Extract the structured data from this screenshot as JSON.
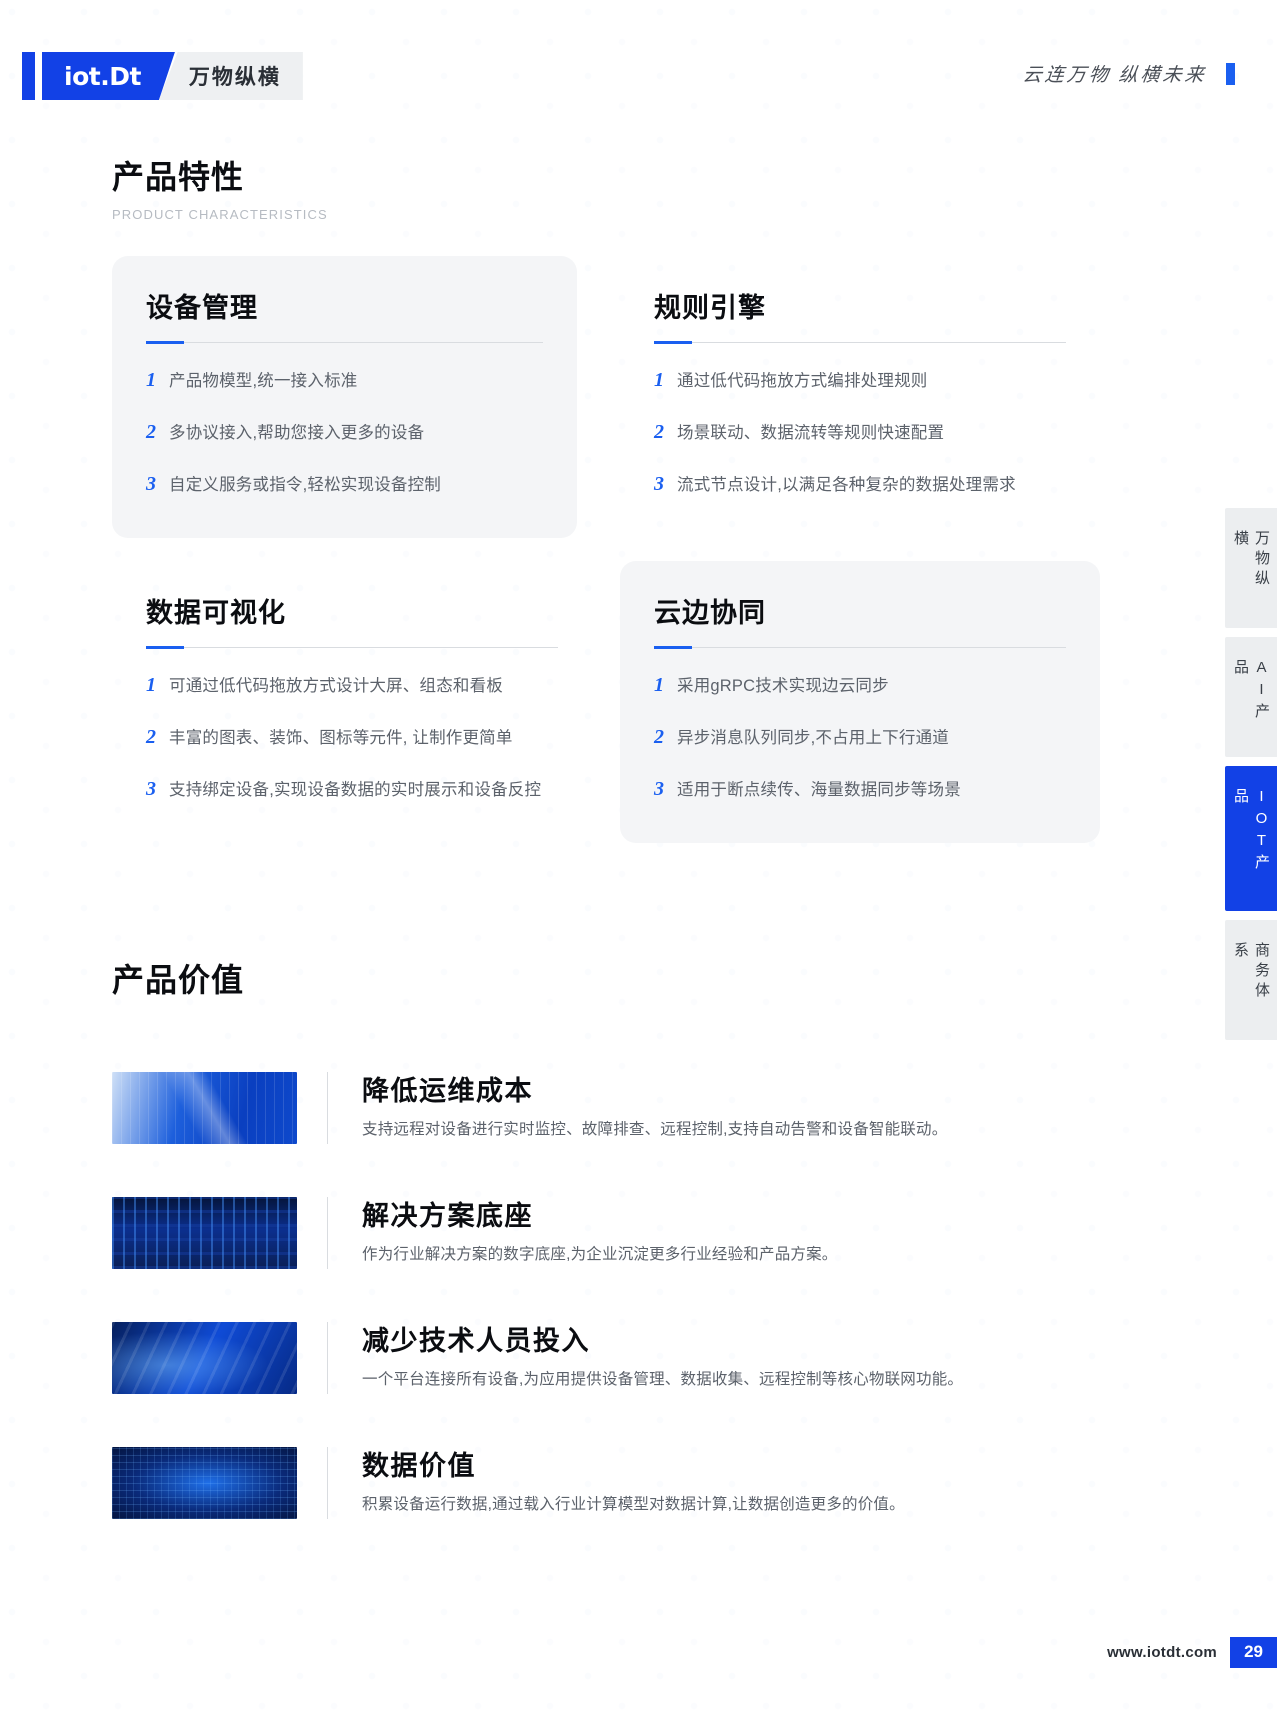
{
  "header": {
    "logo_text": "iot.Dt",
    "brand_sub": "万物纵横",
    "slogan": "云连万物  纵横未来"
  },
  "section1": {
    "title": "产品特性",
    "subtitle": "PRODUCT CHARACTERISTICS",
    "cards": [
      {
        "title": "设备管理",
        "features": [
          {
            "num": "1",
            "text": "产品物模型,统一接入标准"
          },
          {
            "num": "2",
            "text": "多协议接入,帮助您接入更多的设备"
          },
          {
            "num": "3",
            "text": "自定义服务或指令,轻松实现设备控制"
          }
        ]
      },
      {
        "title": "规则引擎",
        "features": [
          {
            "num": "1",
            "text": "通过低代码拖放方式编排处理规则"
          },
          {
            "num": "2",
            "text": "场景联动、数据流转等规则快速配置"
          },
          {
            "num": "3",
            "text": "流式节点设计,以满足各种复杂的数据处理需求"
          }
        ]
      },
      {
        "title": "数据可视化",
        "features": [
          {
            "num": "1",
            "text": "可通过低代码拖放方式设计大屏、组态和看板"
          },
          {
            "num": "2",
            "text": "丰富的图表、装饰、图标等元件, 让制作更简单"
          },
          {
            "num": "3",
            "text": "支持绑定设备,实现设备数据的实时展示和设备反控"
          }
        ]
      },
      {
        "title": "云边协同",
        "features": [
          {
            "num": "1",
            "text": "采用gRPC技术实现边云同步"
          },
          {
            "num": "2",
            "text": "异步消息队列同步,不占用上下行通道"
          },
          {
            "num": "3",
            "text": "适用于断点续传、海量数据同步等场景"
          }
        ]
      }
    ]
  },
  "section2": {
    "title": "产品价值",
    "items": [
      {
        "heading": "降低运维成本",
        "desc": "支持远程对设备进行实时监控、故障排查、远程控制,支持自动告警和设备智能联动。",
        "thumb": "growth-chart-image"
      },
      {
        "heading": "解决方案底座",
        "desc": "作为行业解决方案的数字底座,为企业沉淀更多行业经验和产品方案。",
        "thumb": "server-room-image"
      },
      {
        "heading": "减少技术人员投入",
        "desc": "一个平台连接所有设备,为应用提供设备管理、数据收集、远程控制等核心物联网功能。",
        "thumb": "control-room-image"
      },
      {
        "heading": "数据价值",
        "desc": "积累设备运行数据,通过载入行业计算模型对数据计算,让数据创造更多的价值。",
        "thumb": "data-globe-image"
      }
    ]
  },
  "tabs": [
    {
      "label": "万物纵横",
      "active": false
    },
    {
      "label": "AI产品",
      "active": false
    },
    {
      "label": "IOT产品",
      "active": true
    },
    {
      "label": "商务体系",
      "active": false
    }
  ],
  "footer": {
    "url": "www.iotdt.com",
    "page": "29"
  },
  "colors": {
    "brand_blue": "#1241e6",
    "accent_blue": "#1a5ff0",
    "card_bg": "#f4f5f7",
    "body_text": "#5c626b",
    "heading": "#0b0d11"
  }
}
